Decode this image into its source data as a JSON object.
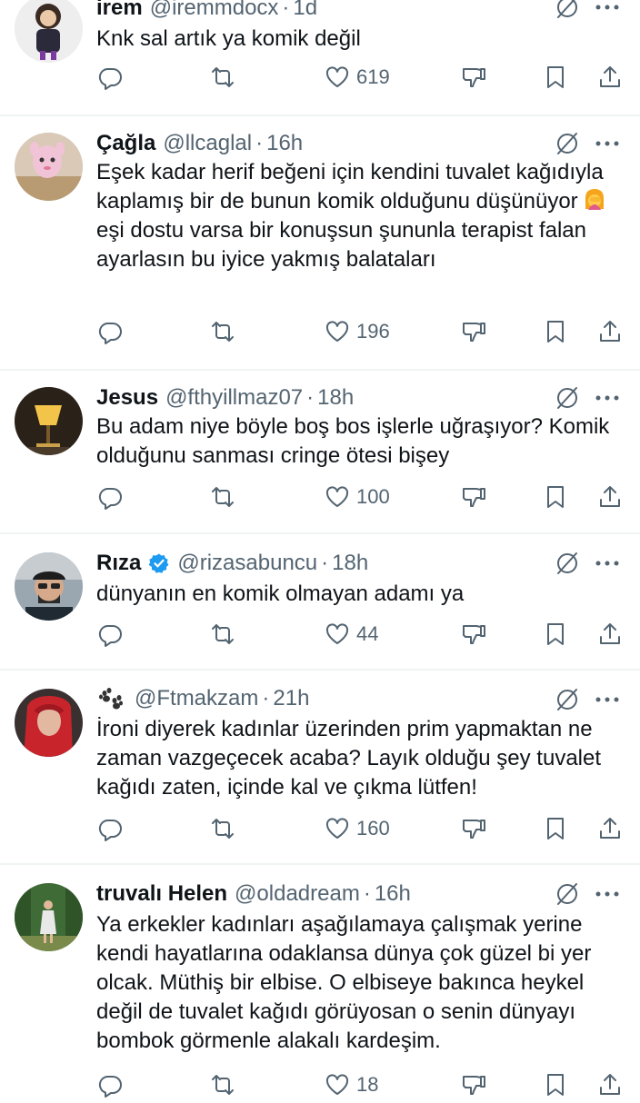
{
  "tweets": [
    {
      "name": "irem",
      "handle": "@iremmdocx",
      "time": "1d",
      "text": "Knk sal artık ya komik değil",
      "likes": "619"
    },
    {
      "name": "Çağla",
      "handle": "@llcaglal",
      "time": "16h",
      "text_before_emoji": "Eşek kadar herif beğeni için kendini tuvalet kağıdıyla kaplamış bir de bunun komik olduğunu düşünüyor",
      "emoji": "woman-facepalming-emoji",
      "text_after_emoji": "eşi dostu varsa bir konuşsun şununla terapist falan ayarlasın bu iyice yakmış balataları",
      "likes": "196"
    },
    {
      "name": "Jesus",
      "handle": "@fthyillmaz07",
      "time": "18h",
      "text": "Bu adam niye böyle boş bos işlerle uğraşıyor? Komik olduğunu sanması cringe ötesi bişey",
      "likes": "100"
    },
    {
      "name": "Rıza",
      "verified": true,
      "handle": "@rizasabuncu",
      "time": "18h",
      "text": "dünyanın en komik olmayan adamı ya",
      "likes": "44"
    },
    {
      "name_icon": "paw-prints-icon",
      "handle": "@Ftmakzam",
      "time": "21h",
      "text": "İroni diyerek kadınlar üzerinden prim yapmaktan ne zaman vazgeçecek acaba?  Layık olduğu şey tuvalet kağıdı zaten, içinde kal ve çıkma lütfen!",
      "likes": "160"
    },
    {
      "name": "truvalı Helen",
      "handle": "@oldadream",
      "time": "16h",
      "text": "Ya erkekler kadınları aşağılamaya çalışmak yerine kendi hayatlarına odaklansa dünya çok güzel bi yer olcak. Müthiş bir elbise. O elbiseye bakınca heykel değil de tuvalet kağıdı görüyosan o senin dünyayı bombok görmenle alakalı kardeşim.",
      "likes": "18"
    }
  ],
  "separator": "·",
  "colors": {
    "text": "#0f1419",
    "secondary": "#536471",
    "verified": "#1d9bf0",
    "separator": "#eff3f4"
  }
}
